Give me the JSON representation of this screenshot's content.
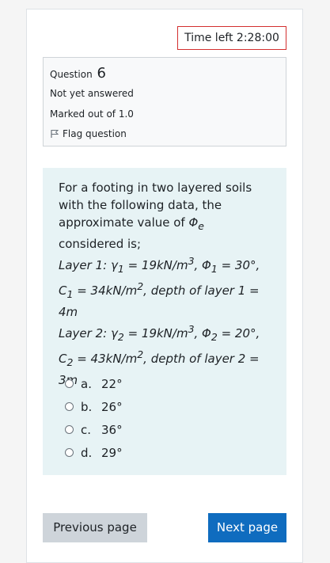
{
  "timer": {
    "label": "Time left 2:28:00"
  },
  "question_info": {
    "prefix": "Question",
    "number": "6",
    "state": "Not yet answered",
    "grade": "Marked out of 1.0",
    "flag_label": "Flag question"
  },
  "question": {
    "line1": "For a footing in two layered soils",
    "line2": "with the following data, the",
    "line3_a": "approximate value of ",
    "line3_phi": "Φ",
    "line3_sub": "e",
    "line4": "considered is;",
    "layer1_a": "Layer 1:   γ",
    "layer1_b": " = 19kN/m",
    "layer1_c": ",  Φ",
    "layer1_d": "  = 30°,",
    "layer1_e": "  C",
    "layer1_f": " = 34kN/m",
    "layer1_g": ",  depth of layer 1  =",
    "layer1_h": "4m",
    "layer2_a": "Layer 2:   γ",
    "layer2_b": " = 19kN/m",
    "layer2_c": ",  Φ",
    "layer2_d": "  = 20°,",
    "layer2_e": "  C",
    "layer2_f": " = 43kN/m",
    "layer2_g": ",  depth of layer 2  =",
    "layer2_h": "3m",
    "sub1": "1",
    "sub2": "2",
    "sup3": "3",
    "sup2": "2"
  },
  "answers": [
    {
      "letter": "a.",
      "value": "22°"
    },
    {
      "letter": "b.",
      "value": "26°"
    },
    {
      "letter": "c.",
      "value": "36°"
    },
    {
      "letter": "d.",
      "value": "29°"
    }
  ],
  "nav": {
    "prev_label": "Previous page",
    "next_label": "Next page"
  }
}
